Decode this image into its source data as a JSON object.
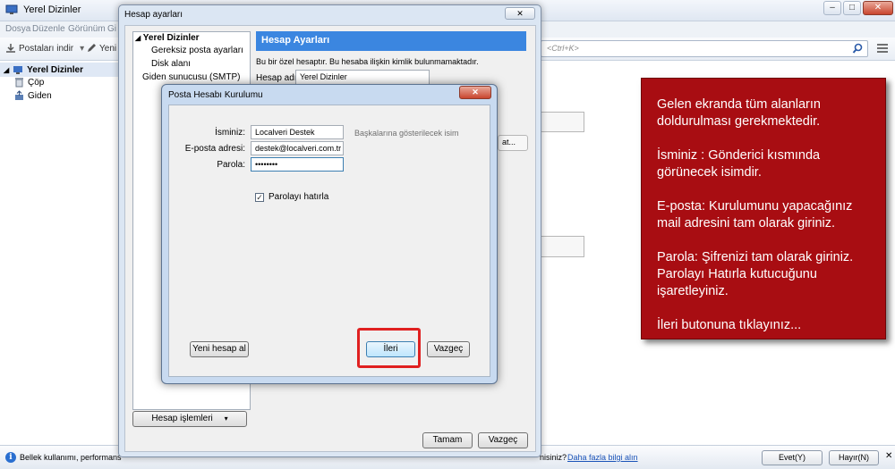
{
  "main_window": {
    "title": "Yerel Dizinler",
    "controls": {
      "minimize": "–",
      "maximize": "□",
      "close": "✕"
    },
    "menu": [
      "Dosya",
      "Düzenle",
      "Görünüm",
      "Gi"
    ],
    "toolbar": {
      "get_mail": "Postaları indir",
      "write": "Yeni il"
    },
    "search": {
      "placeholder": "<Ctrl+K>"
    },
    "folders": {
      "root": "Yerel Dizinler",
      "trash": "Çöp",
      "outbox": "Giden"
    }
  },
  "status_bar": {
    "message": "Bellek kullanımı, performans",
    "message_tail": "nisiniz?",
    "link": "Daha fazla bilgi alın",
    "yes": "Evet(Y)",
    "no": "Hayır(N)"
  },
  "account_settings": {
    "title": "Hesap ayarları",
    "close": "✕",
    "tree": {
      "root": "Yerel Dizinler",
      "items": [
        "Gereksiz posta ayarları",
        "Disk alanı"
      ],
      "smtp": "Giden sunucusu (SMTP)"
    },
    "panel_title": "Hesap Ayarları",
    "panel_text": "Bu bir özel hesaptır. Bu hesaba ilişkin kimlik bulunmamaktadır.",
    "account_name_label": "Hesap adı:",
    "account_name_value": "Yerel Dizinler",
    "account_actions": "Hesap işlemleri",
    "ok": "Tamam",
    "cancel": "Vazgeç",
    "partial_button": "at..."
  },
  "setup_dialog": {
    "title": "Posta Hesabı Kurulumu",
    "close": "✕",
    "name_label": "İsminiz:",
    "name_value": "Localveri Destek",
    "name_hint": "Başkalarına gösterilecek isim",
    "email_label": "E-posta adresi:",
    "email_value": "destek@localveri.com.tr",
    "password_label": "Parola:",
    "password_value": "••••••••",
    "remember_label": "Parolayı hatırla",
    "remember_checked": true,
    "new_account": "Yeni hesap al",
    "next": "İleri",
    "cancel": "Vazgeç"
  },
  "annotation": {
    "color": "#a80d12",
    "paragraphs": [
      "Gelen ekranda tüm alanların doldurulması gerekmektedir.",
      "İsminiz : Gönderici kısmında görünecek isimdir.",
      "E-posta: Kurulumunu yapacağınız mail adresini tam olarak giriniz.",
      "Parola: Şifrenizi tam olarak giriniz. Parolayı Hatırla kutucuğunu işaretleyiniz.",
      "İleri butonuna tıklayınız..."
    ]
  }
}
